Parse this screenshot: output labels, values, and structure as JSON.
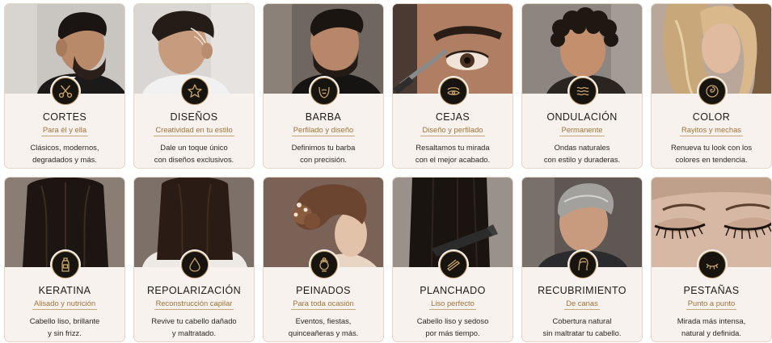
{
  "accent_color": "#b8955e",
  "services": [
    {
      "title": "CORTES",
      "subtitle": "Para él y ella",
      "desc": [
        "Clásicos, modernos,",
        "degradados y más."
      ],
      "icon": "scissors-icon"
    },
    {
      "title": "DISEÑOS",
      "subtitle": "Creatividad en tu estilo",
      "desc": [
        "Dale un toque único",
        "con diseños exclusivos."
      ],
      "icon": "star-icon"
    },
    {
      "title": "BARBA",
      "subtitle": "Perfilado y diseño",
      "desc": [
        "Definimos tu barba",
        "con precisión."
      ],
      "icon": "beard-icon"
    },
    {
      "title": "CEJAS",
      "subtitle": "Diseño y perfilado",
      "desc": [
        "Resaltamos tu mirada",
        "con el mejor acabado."
      ],
      "icon": "eyebrow-icon"
    },
    {
      "title": "ONDULACIÓN",
      "subtitle": "Permanente",
      "desc": [
        "Ondas naturales",
        "con estilo y duraderas."
      ],
      "icon": "waves-icon"
    },
    {
      "title": "COLOR",
      "subtitle": "Rayitos y mechas",
      "desc": [
        "Renueva tu look con los",
        "colores en tendencia."
      ],
      "icon": "color-swirl-icon"
    },
    {
      "title": "KERATINA",
      "subtitle": "Alisado y nutrición",
      "desc": [
        "Cabello liso, brillante",
        "y sin frizz."
      ],
      "icon": "bottle-icon"
    },
    {
      "title": "REPOLARIZACIÓN",
      "subtitle": "Reconstrucción capilar",
      "desc": [
        "Revive tu cabello dañado",
        "y maltratado."
      ],
      "icon": "drop-icon"
    },
    {
      "title": "PEINADOS",
      "subtitle": "Para toda ocasión",
      "desc": [
        "Eventos, fiestas,",
        "quinceañeras y más."
      ],
      "icon": "updo-icon"
    },
    {
      "title": "PLANCHADO",
      "subtitle": "Liso perfecto",
      "desc": [
        "Cabello liso y sedoso",
        "por más tiempo."
      ],
      "icon": "flat-iron-icon"
    },
    {
      "title": "RECUBRIMIENTO",
      "subtitle": "De canas",
      "desc": [
        "Cobertura natural",
        "sin maltratar tu cabello."
      ],
      "icon": "head-icon"
    },
    {
      "title": "PESTAÑAS",
      "subtitle": "Punto a punto",
      "desc": [
        "Mirada más intensa,",
        "natural y definida."
      ],
      "icon": "eyelash-icon"
    }
  ]
}
